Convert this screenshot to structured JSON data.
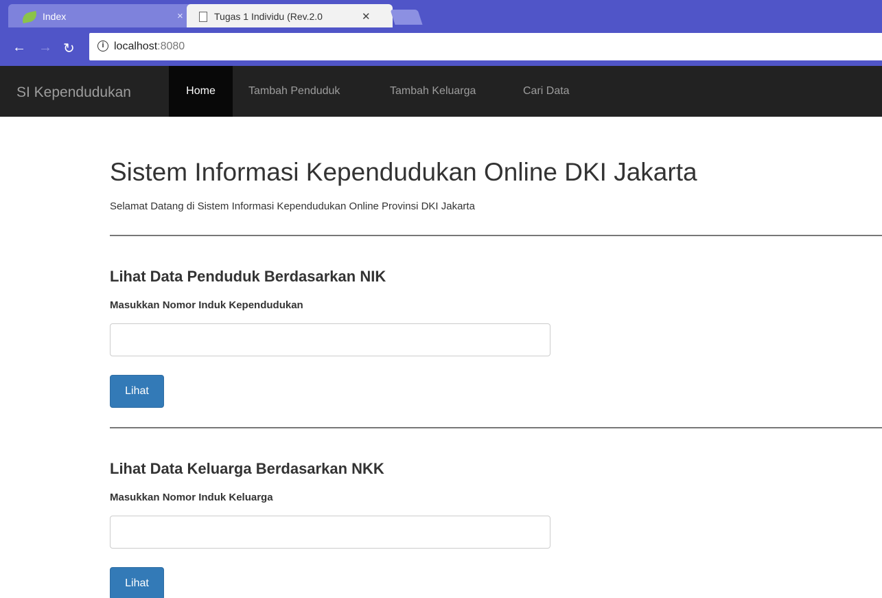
{
  "browser": {
    "tabs": [
      {
        "label": "Index",
        "close": "×"
      },
      {
        "label": "Tugas 1 Individu (Rev.2.0",
        "close": "✕"
      }
    ],
    "url": {
      "host": "localhost",
      "port": ":8080"
    },
    "icons": {
      "back": "arrow-left-icon",
      "forward": "arrow-right-icon",
      "reload": "reload-icon",
      "info": "info-icon"
    }
  },
  "navbar": {
    "brand": "SI Kependudukan",
    "items": [
      {
        "label": "Home",
        "active": true
      },
      {
        "label": "Tambah Penduduk",
        "active": false
      },
      {
        "label": "Tambah Keluarga",
        "active": false
      },
      {
        "label": "Cari Data",
        "active": false
      }
    ]
  },
  "main": {
    "title": "Sistem Informasi Kependudukan Online DKI Jakarta",
    "subtitle": "Selamat Datang di Sistem Informasi Kependudukan Online Provinsi DKI Jakarta",
    "sections": [
      {
        "title": "Lihat Data Penduduk Berdasarkan NIK",
        "label": "Masukkan Nomor Induk Kependudukan",
        "value": "",
        "button": "Lihat"
      },
      {
        "title": "Lihat Data Keluarga Berdasarkan NKK",
        "label": "Masukkan Nomor Induk Keluarga",
        "value": "",
        "button": "Lihat"
      }
    ]
  },
  "colors": {
    "browser_chrome": "#5055c8",
    "navbar_bg": "#222222",
    "navbar_active": "#080808",
    "primary_button": "#337ab7"
  }
}
